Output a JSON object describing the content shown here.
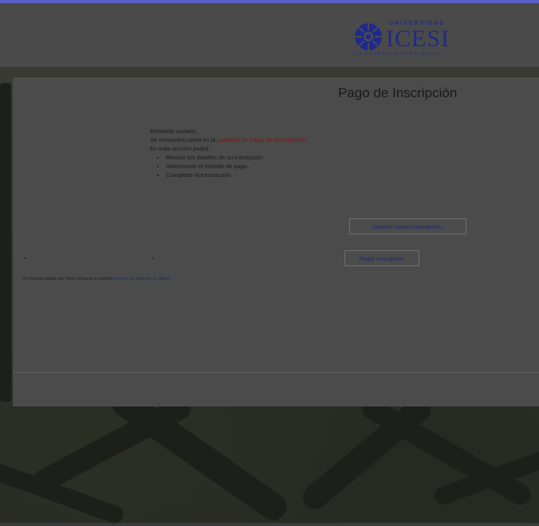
{
  "brand": {
    "top": "UNIVERSIDAD",
    "name": "ICESI",
    "tagline": "TU FUTURO A OTRO NIVEL",
    "color": "#1f2a8a"
  },
  "page": {
    "title": "Pago de Inscripción"
  },
  "message": {
    "greeting": "Estimado usuario,",
    "line_prefix": "Se encuentra usted en la ",
    "line_highlight": "pantalla de Pago de inscripción.",
    "intro": "En esta sección podrá:",
    "items": [
      "Revisar los detalles de su inscripción",
      "Seleccionar el método de pago",
      "Completar la transacción"
    ]
  },
  "buttons": {
    "invoice": "Generar factura inscripción.",
    "pay": "Pagar Inscripción"
  },
  "help": {
    "prefix": "Si necesita ayuda, por favor contacte a nuestro ",
    "link": "servicio de atención al cliente."
  }
}
